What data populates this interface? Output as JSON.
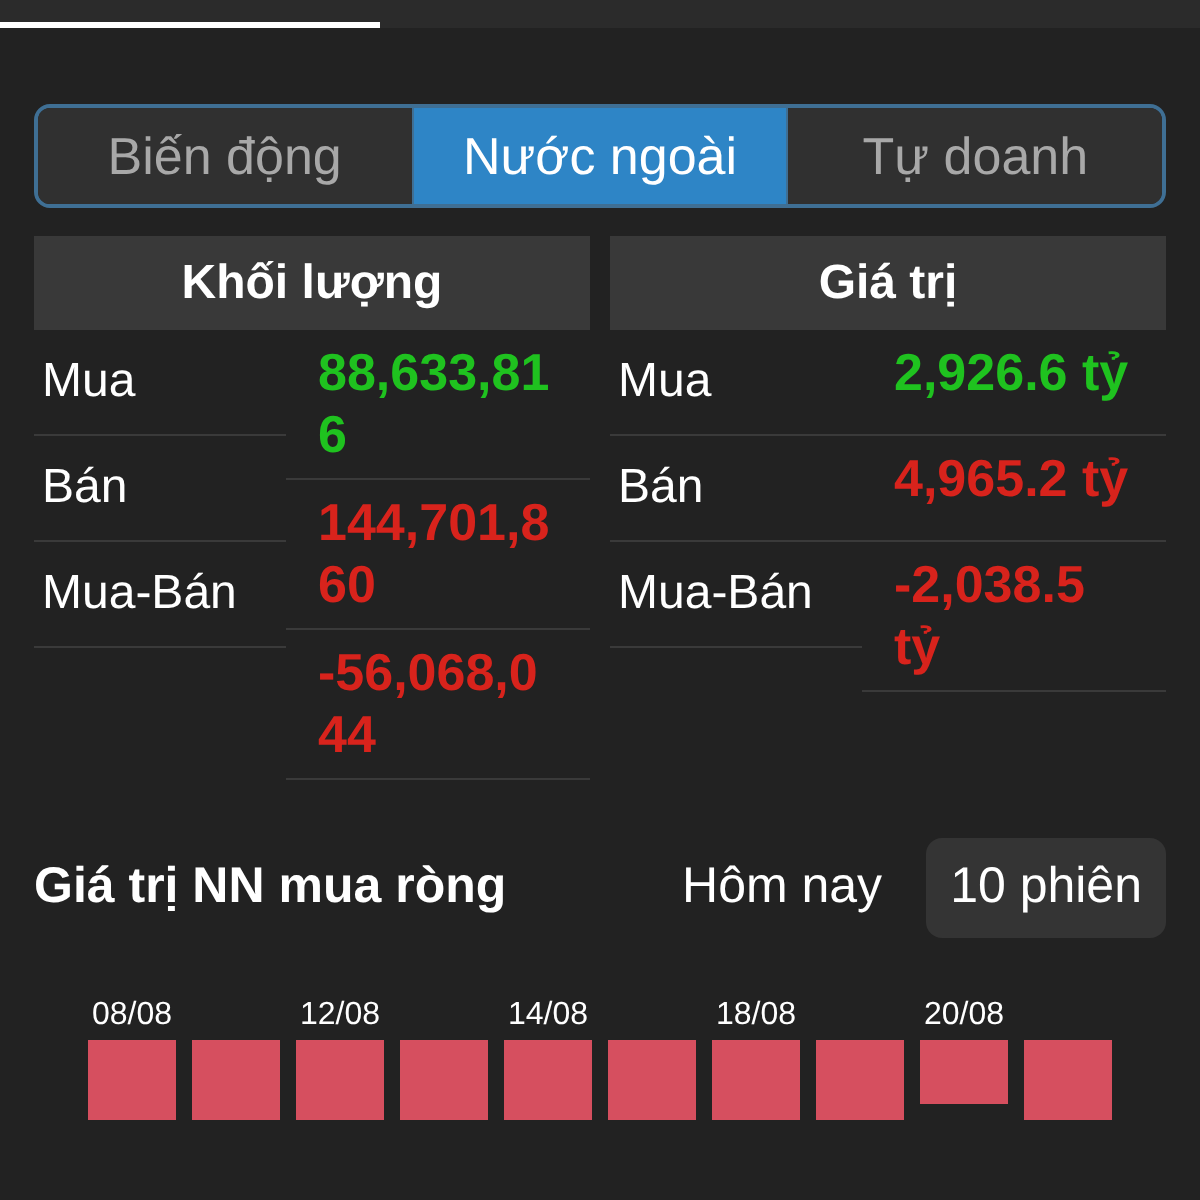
{
  "tabs": [
    {
      "label": "Biến động",
      "selected": false
    },
    {
      "label": "Nước ngoài",
      "selected": true
    },
    {
      "label": "Tự doanh",
      "selected": false
    }
  ],
  "tables": [
    {
      "title": "Khối lượng",
      "labels": [
        "Mua",
        "Bán",
        "Mua-Bán"
      ],
      "values": [
        {
          "text": "88,633,816",
          "color": "#1fc21f"
        },
        {
          "text": "144,701,860",
          "color": "#d8231c"
        },
        {
          "text": "-56,068,044",
          "color": "#d8231c"
        }
      ]
    },
    {
      "title": "Giá trị",
      "labels": [
        "Mua",
        "Bán",
        "Mua-Bán"
      ],
      "values": [
        {
          "text": "2,926.6 tỷ",
          "color": "#1fc21f"
        },
        {
          "text": "4,965.2 tỷ",
          "color": "#d8231c"
        },
        {
          "text": "-2,038.5 tỷ",
          "color": "#d8231c"
        }
      ]
    }
  ],
  "section": {
    "title": "Giá trị NN mua ròng",
    "periods": [
      {
        "label": "Hôm nay",
        "selected": false
      },
      {
        "label": "10 phiên",
        "selected": true
      }
    ]
  },
  "date_labels": [
    "08/08",
    "12/08",
    "14/08",
    "18/08",
    "20/08"
  ]
}
